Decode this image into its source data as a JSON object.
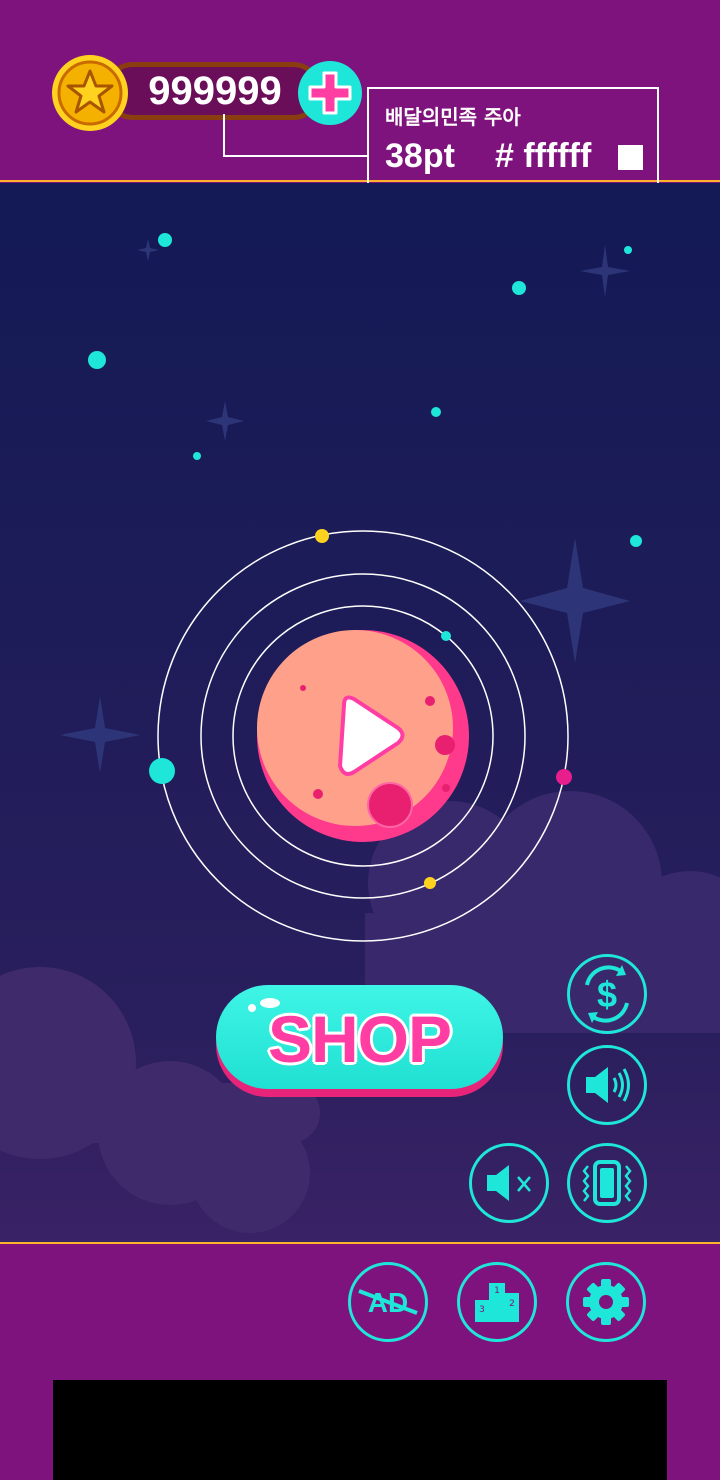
{
  "coins": {
    "amount": "999999"
  },
  "font_note": {
    "font_name": "배달의민족 주아",
    "size": "38pt",
    "color_code": "# ffffff"
  },
  "shop": {
    "label": "SHOP"
  },
  "side_buttons": [
    "currency-exchange",
    "sound-on",
    "sound-mute",
    "vibration"
  ],
  "bottom_buttons": [
    "remove-ads",
    "leaderboard",
    "settings"
  ],
  "leaderboard_ranks": [
    "1",
    "2",
    "3"
  ],
  "ad_label": "AD",
  "colors": {
    "background": "#7f137d",
    "accent": "#1ee6d8",
    "pink": "#ff3da2",
    "planet": "#ffa18a",
    "gold": "#ffd21f",
    "divider": "#ffb22c"
  }
}
